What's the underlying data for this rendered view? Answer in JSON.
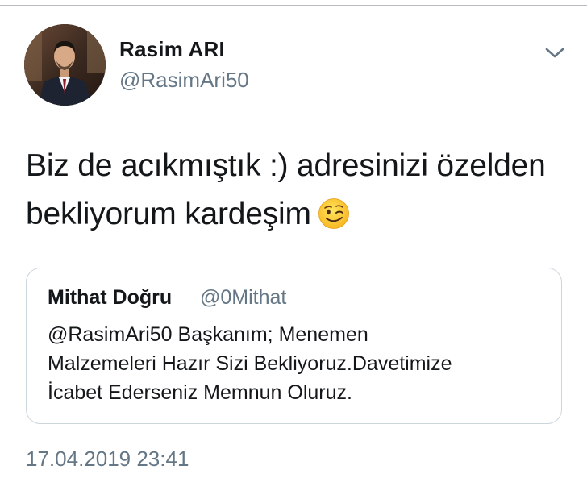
{
  "author": {
    "display_name": "Rasim ARI",
    "handle": "@RasimAri50"
  },
  "menu_icon": "chevron-down-icon",
  "tweet": {
    "text_lines": [
      "Biz de acıkmıştık :) adresinizi özelden",
      "bekliyorum kardeşim"
    ],
    "emoji": "winking-face"
  },
  "quoted_tweet": {
    "display_name": "Mithat Doğru",
    "handle": "@0Mithat",
    "text_lines": [
      "@RasimAri50 Başkanım; Menemen",
      "Malzemeleri Hazır Sizi Bekliyoruz.Davetimize",
      "İcabet Ederseniz Memnun Oluruz."
    ]
  },
  "timestamp": "17.04.2019 23:41",
  "colors": {
    "primary_text": "#14171a",
    "secondary_text": "#657786",
    "border": "#ccd6dd"
  }
}
